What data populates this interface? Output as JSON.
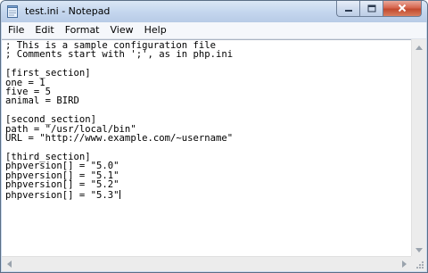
{
  "window": {
    "title": "test.ini - Notepad"
  },
  "menu": {
    "items": [
      {
        "label": "File"
      },
      {
        "label": "Edit"
      },
      {
        "label": "Format"
      },
      {
        "label": "View"
      },
      {
        "label": "Help"
      }
    ]
  },
  "editor": {
    "lines": [
      "; This is a sample configuration file",
      "; Comments start with ';', as in php.ini",
      "",
      "[first_section]",
      "one = 1",
      "five = 5",
      "animal = BIRD",
      "",
      "[second_section]",
      "path = \"/usr/local/bin\"",
      "URL = \"http://www.example.com/~username\"",
      "",
      "[third_section]",
      "phpversion[] = \"5.0\"",
      "phpversion[] = \"5.1\"",
      "phpversion[] = \"5.2\"",
      "phpversion[] = \"5.3\""
    ]
  },
  "icons": {
    "app": "notepad-icon",
    "minimize": "minimize-icon",
    "maximize": "maximize-icon",
    "close": "close-icon",
    "scroll_up": "arrow-up-icon",
    "scroll_down": "arrow-down-icon",
    "scroll_left": "arrow-left-icon",
    "scroll_right": "arrow-right-icon",
    "size_grip": "resize-grip-icon"
  },
  "colors": {
    "close_button": "#c24a2f",
    "frame": "#c9d9ee"
  }
}
